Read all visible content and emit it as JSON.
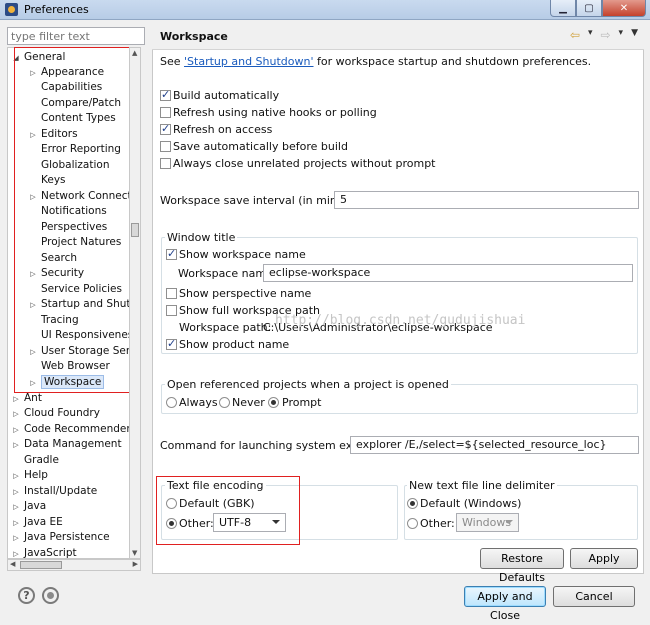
{
  "window": {
    "title": "Preferences"
  },
  "filter": {
    "placeholder": "type filter text"
  },
  "tree": {
    "general": "General",
    "children": [
      "Appearance",
      "Capabilities",
      "Compare/Patch",
      "Content Types",
      "Editors",
      "Error Reporting",
      "Globalization",
      "Keys",
      "Network Connecti",
      "Notifications",
      "Perspectives",
      "Project Natures",
      "Search",
      "Security",
      "Service Policies",
      "Startup and Shutd",
      "Tracing",
      "UI Responsivenes",
      "User Storage Serv",
      "Web Browser",
      "Workspace"
    ],
    "roots": [
      "Ant",
      "Cloud Foundry",
      "Code Recommenders",
      "Data Management",
      "Gradle",
      "Help",
      "Install/Update",
      "Java",
      "Java EE",
      "Java Persistence",
      "JavaScript"
    ]
  },
  "page": {
    "title": "Workspace",
    "intro_prefix": "See ",
    "intro_link": "'Startup and Shutdown'",
    "intro_suffix": " for workspace startup and shutdown preferences.",
    "checkboxes": [
      {
        "label": "Build automatically",
        "checked": true
      },
      {
        "label": "Refresh using native hooks or polling",
        "checked": false
      },
      {
        "label": "Refresh on access",
        "checked": true
      },
      {
        "label": "Save automatically before build",
        "checked": false
      },
      {
        "label": "Always close unrelated projects without prompt",
        "checked": false
      }
    ],
    "save_interval_label": "Workspace save interval (in minutes):",
    "save_interval_value": "5",
    "window_title": {
      "label": "Window title",
      "show_workspace_name": "Show workspace name",
      "workspace_name_label": "Workspace name:",
      "workspace_name_value": "eclipse-workspace",
      "show_perspective_name": "Show perspective name",
      "show_full_path": "Show full workspace path",
      "workspace_path_label": "Workspace path:",
      "workspace_path_value": "C:\\Users\\Administrator\\eclipse-workspace",
      "show_product_name": "Show product name"
    },
    "open_projects": {
      "label": "Open referenced projects when a project is opened",
      "options": [
        "Always",
        "Never",
        "Prompt"
      ],
      "selected": "Prompt"
    },
    "explorer_label": "Command for launching system explorer:",
    "explorer_value": "explorer /E,/select=${selected_resource_loc}",
    "encoding": {
      "label": "Text file encoding",
      "default_option": "Default (GBK)",
      "other_option": "Other:",
      "other_value": "UTF-8"
    },
    "delimiter": {
      "label": "New text file line delimiter",
      "default_option": "Default (Windows)",
      "other_option": "Other:",
      "other_value": "Windows"
    },
    "restore_defaults": "Restore Defaults",
    "apply": "Apply"
  },
  "footer": {
    "apply_close": "Apply and Close",
    "cancel": "Cancel",
    "help_glyph": "?"
  },
  "watermark": "http://blog.csdn.net/gudujishuai",
  "colors": {
    "highlight_box": "#e02020",
    "link": "#1a5bbd"
  }
}
